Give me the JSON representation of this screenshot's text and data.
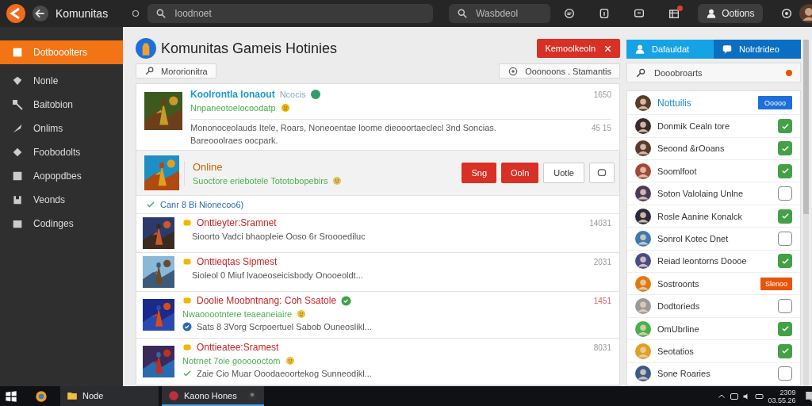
{
  "topbar": {
    "app_title": "Komunitas",
    "search_placeholder": "Ioodnoet",
    "search2_placeholder": "Wasbdeol",
    "options_button": "Ootions"
  },
  "sidebar": {
    "items": [
      {
        "label": "Dotbooolters",
        "selected": true
      },
      {
        "label": "Nonle",
        "selected": false
      },
      {
        "label": "Baitobion",
        "selected": false
      },
      {
        "label": "Onlims",
        "selected": false
      },
      {
        "label": "Foobodolts",
        "selected": false
      },
      {
        "label": "Aopopdbes",
        "selected": false
      },
      {
        "label": "Veonds",
        "selected": false
      },
      {
        "label": "Codinges",
        "selected": false
      }
    ]
  },
  "page": {
    "title": "Komunitas Gameis Hotinies",
    "close_button": "Kemoolkeoln",
    "filter_button": "Mororionitra",
    "sort_chip": "Ooonoons . Stamantis"
  },
  "feed": [
    {
      "kind": "post",
      "title": "Koolrontla lonaout",
      "tag": "Ncocis",
      "subtitle": "Nnpaneotoelocoodatp",
      "time": "1650",
      "body": [
        "Mononoceolauds Itele, Roars, Noneoentae loome dieooortaeclecl 3nd Soncias.",
        "Bareooolraes oocpark."
      ],
      "time2": "45 15"
    },
    {
      "kind": "highlight",
      "title": "Online",
      "subtitle": "Suoctore eriebotele Tototobopebirs",
      "buttons": [
        {
          "label": "Sng"
        },
        {
          "label": "Ooln"
        },
        {
          "label": "Uotle"
        }
      ],
      "footer": {
        "kind": "check",
        "text": "Canr 8 Bi Nionecoo6)"
      }
    },
    {
      "kind": "news",
      "title": "Onttieyter:Sramnet",
      "footer": {
        "kind": "plain",
        "text": "Sioorto Vadci bhaopleie Ooso 6r Sroooediluc"
      },
      "time": "14031",
      "verified": false
    },
    {
      "kind": "news",
      "title": "Onttieqtas Sipmest",
      "footer": {
        "kind": "plain",
        "text": "Sioleol 0 Miuf lvaoeoseicisbody Onooeoldt..."
      },
      "time": "2031",
      "verified": false
    },
    {
      "kind": "news",
      "title": "Doolie Moobntnang: Coh Ssatole",
      "subtitle": "Nwaooootntere teaeaneiaire",
      "footer": {
        "kind": "badge",
        "text": "Sats 8 3Vorg Scrpoertuel Sabob Ouneoslikl..."
      },
      "time": "1451",
      "verified": true
    },
    {
      "kind": "news",
      "title": "Onttieatee:Sramest",
      "subtitle": "Notrnet 7oie goooooctom",
      "footer": {
        "kind": "check",
        "text": "Zaie Cio Muar Ooodaeoortekog Sunneodikl..."
      },
      "time": "8031",
      "verified": false
    }
  ],
  "friends": {
    "tabs": [
      {
        "label": "Dafauldat",
        "selected": true
      },
      {
        "label": "Nolrdrideo",
        "selected": false
      }
    ],
    "search_placeholder": "Dooobroarts",
    "header": "Nottuilis",
    "header_button": "Ooooo",
    "items": [
      {
        "name": "Donmik Cealn tore",
        "kind": "check",
        "checked": true
      },
      {
        "name": "Seoond &rOoans",
        "kind": "check",
        "checked": true
      },
      {
        "name": "Soomlfoot",
        "kind": "check",
        "checked": true
      },
      {
        "name": "Soton Valolaing Unlne",
        "kind": "check",
        "checked": false
      },
      {
        "name": "Rosle Aanine Konalck",
        "kind": "check",
        "checked": true
      },
      {
        "name": "Sonrol Kotec Dnet",
        "kind": "check",
        "checked": false
      },
      {
        "name": "Reiad leontorns Doooe",
        "kind": "check",
        "checked": true
      },
      {
        "name": "Sostroonts",
        "kind": "badge",
        "badge": "Slenoo"
      },
      {
        "name": "Dodtorieds",
        "kind": "check",
        "checked": false
      },
      {
        "name": "OmUbrline",
        "kind": "check",
        "checked": true
      },
      {
        "name": "Seotatios",
        "kind": "check",
        "checked": true
      },
      {
        "name": "Sone Roaries",
        "kind": "check",
        "checked": false
      }
    ]
  },
  "taskbar": {
    "apps": [
      {
        "label": "Node",
        "selected": false
      },
      {
        "label": "Kaono Hones",
        "selected": true
      }
    ],
    "clock": [
      "2309",
      "03.55.26"
    ]
  }
}
